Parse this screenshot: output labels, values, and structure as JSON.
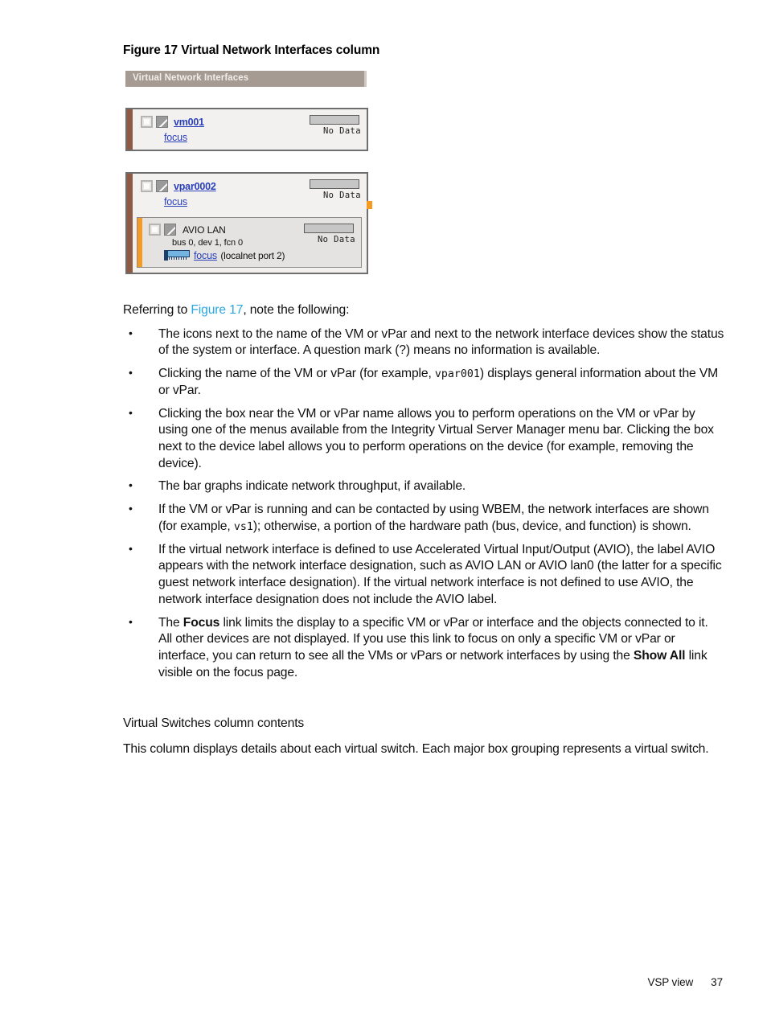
{
  "figure": {
    "caption": "Figure 17 Virtual Network Interfaces column",
    "column_header": "Virtual Network Interfaces",
    "boxes": [
      {
        "name": "vm001",
        "focus_label": "focus",
        "graph_label": "No Data",
        "status_icon": "unknown-status-icon",
        "accent_color": "#8d5a44"
      },
      {
        "name": "vpar0002",
        "focus_label": "focus",
        "graph_label": "No Data",
        "status_icon": "unknown-status-icon",
        "accent_color": "#8d5a44",
        "device": {
          "label": "AVIO LAN",
          "hardware_path": "bus 0, dev 1, fcn 0",
          "focus_label": "focus",
          "port_note": "(localnet port 2)",
          "graph_label": "No Data",
          "nic_icon": "network-card-icon",
          "accent_color": "#f59a22"
        }
      }
    ]
  },
  "body": {
    "intro_prefix": "Referring to ",
    "intro_link": "Figure 17",
    "intro_suffix": ", note the following:",
    "bullets": [
      {
        "id": "bullet-icons-status",
        "text": "The icons next to the name of the VM or vPar and next to the network interface devices show the status of the system or interface. A question mark (?) means no information is available."
      },
      {
        "id": "bullet-clicking-name",
        "text_before_code": "Clicking the name of the VM or vPar (for example, ",
        "code": "vpar001",
        "text_after_code": ") displays general information about the VM or vPar."
      },
      {
        "id": "bullet-clicking-box",
        "text": "Clicking the box near the VM or vPar name allows you to perform operations on the VM or vPar by using one of the menus available from the Integrity Virtual Server Manager menu bar. Clicking the box next to the device label allows you to perform operations on the device (for example, removing the device)."
      },
      {
        "id": "bullet-bar-graphs",
        "text": "The bar graphs indicate network throughput, if available."
      },
      {
        "id": "bullet-wbem",
        "text_before_code": "If the VM or vPar is running and can be contacted by using WBEM, the network interfaces are shown (for example, ",
        "code": "vs1",
        "text_after_code": "); otherwise, a portion of the hardware path (bus, device, and function) is shown."
      },
      {
        "id": "bullet-avio",
        "text": "If the virtual network interface is defined to use Accelerated Virtual Input/Output (AVIO), the label AVIO appears with the network interface designation, such as AVIO LAN or AVIO lan0 (the latter for a specific guest network interface designation). If the virtual network interface is not defined to use AVIO, the network interface designation does not include the AVIO label."
      },
      {
        "id": "bullet-focus",
        "seg1": "The ",
        "bold1": "Focus",
        "seg2": " link limits the display to a specific VM or vPar or interface and the objects connected to it. All other devices are not displayed. If you use this link to focus on only a specific VM or vPar or interface, you can return to see all the VMs or vPars or network interfaces by using the ",
        "bold2": "Show All",
        "seg3": " link visible on the focus page."
      }
    ],
    "subheading": "Virtual Switches column contents",
    "closing_paragraph": "This column displays details about each virtual switch. Each major box grouping represents a virtual switch."
  },
  "footer": {
    "section": "VSP view",
    "page_number": "37"
  }
}
